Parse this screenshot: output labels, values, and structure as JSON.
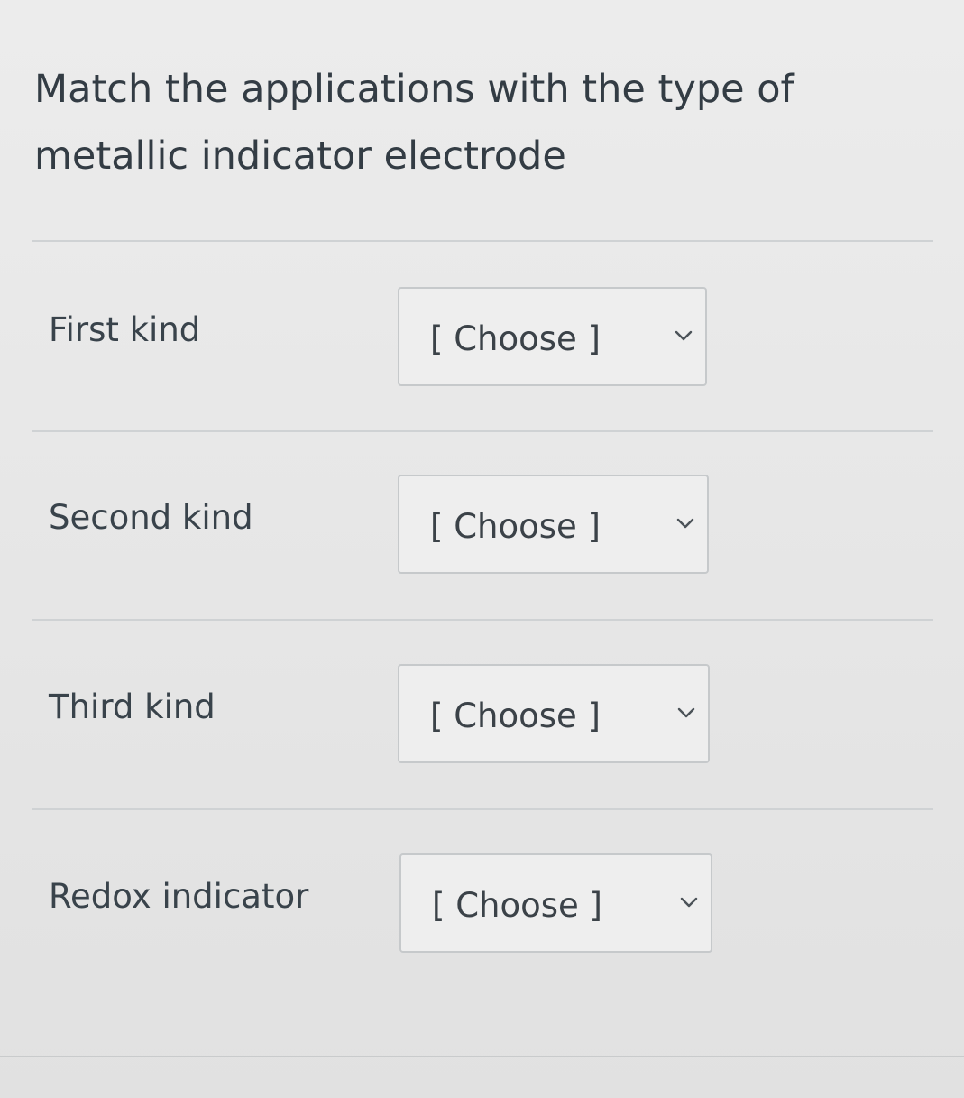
{
  "question": {
    "prompt": "Match the applications with the type of metallic indicator electrode"
  },
  "rows": [
    {
      "label": "First kind",
      "selected": "[ Choose ]",
      "chevron_icon": "chevron-down-icon"
    },
    {
      "label": "Second kind",
      "selected": "[ Choose ]",
      "chevron_icon": "chevron-down-icon"
    },
    {
      "label": "Third kind",
      "selected": "[ Choose ]",
      "chevron_icon": "chevron-down-icon"
    },
    {
      "label": "Redox indicator",
      "selected": "[ Choose ]",
      "chevron_icon": "chevron-down-icon"
    }
  ],
  "colors": {
    "text": "#333c44",
    "border": "#c6c9cb",
    "divider": "#cfd2d4"
  }
}
